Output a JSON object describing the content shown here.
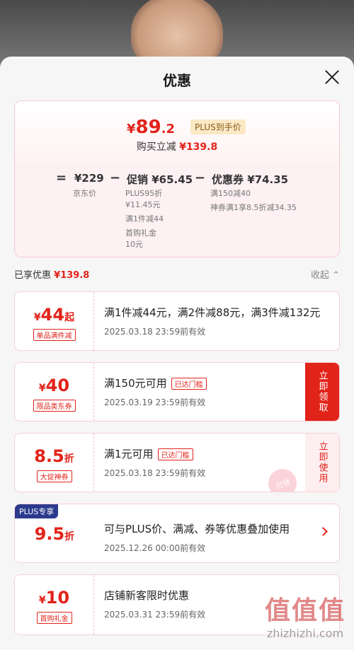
{
  "sheet": {
    "title": "优惠"
  },
  "price": {
    "final_yen": "¥",
    "final_int": "89",
    "final_dec": ".2",
    "plus_tag": "PLUS到手价",
    "save_label": "购买立减",
    "save_amount": "¥139.8"
  },
  "breakdown": {
    "eq": "=",
    "jd_price": "¥229",
    "jd_price_label": "京东价",
    "minus1": "−",
    "promo": "促销 ¥65.45",
    "promo_sub1": "PLUS95折",
    "promo_sub2": "¥11.45元",
    "promo_sub3": "满1件减44",
    "promo_sub4": "首购礼金",
    "promo_sub5": "10元",
    "minus2": "−",
    "coupon": "优惠券 ¥74.35",
    "coupon_sub1": "满150减40",
    "coupon_sub2": "神券满1享8.5折减34.35"
  },
  "shared": {
    "label": "已享优惠",
    "amount": "¥139.8",
    "collapse": "收起 ⌃"
  },
  "coupons": [
    {
      "amount_prefix": "¥",
      "amount": "44",
      "amount_suffix": "起",
      "tag": "单品满件减",
      "condition": "满1件减44元，满2件减88元，满3件减132元",
      "badge": "",
      "expire": "2025.03.18 23:59前有效",
      "action": ""
    },
    {
      "amount_prefix": "¥",
      "amount": "40",
      "amount_suffix": "",
      "tag": "限品类东券",
      "condition": "满150元可用",
      "badge": "已达门槛",
      "expire": "2025.03.19 23:59前有效",
      "action": "立即领取"
    },
    {
      "amount_prefix": "",
      "amount": "8.5",
      "amount_suffix": "折",
      "tag": "大促神券",
      "condition": "满1元可用",
      "badge": "已达门槛",
      "expire": "2025.03.18 23:59前有效",
      "action": "立即使用",
      "stamp": "已领"
    },
    {
      "amount_prefix": "",
      "amount": "9.5",
      "amount_suffix": "折",
      "tag": "",
      "corner": "PLUS专享",
      "condition": "可与PLUS价、满减、券等优惠叠加使用",
      "badge": "",
      "expire": "2025.12.26 00:00前有效",
      "action": ""
    },
    {
      "amount_prefix": "¥",
      "amount": "10",
      "amount_suffix": "",
      "tag": "首购礼金",
      "condition": "店铺新客限时优惠",
      "badge": "",
      "expire": "2025.03.31 23:59前有效",
      "action": ""
    }
  ],
  "watermark": {
    "logo": "值值值",
    "text": "zhizhizhi.com"
  }
}
